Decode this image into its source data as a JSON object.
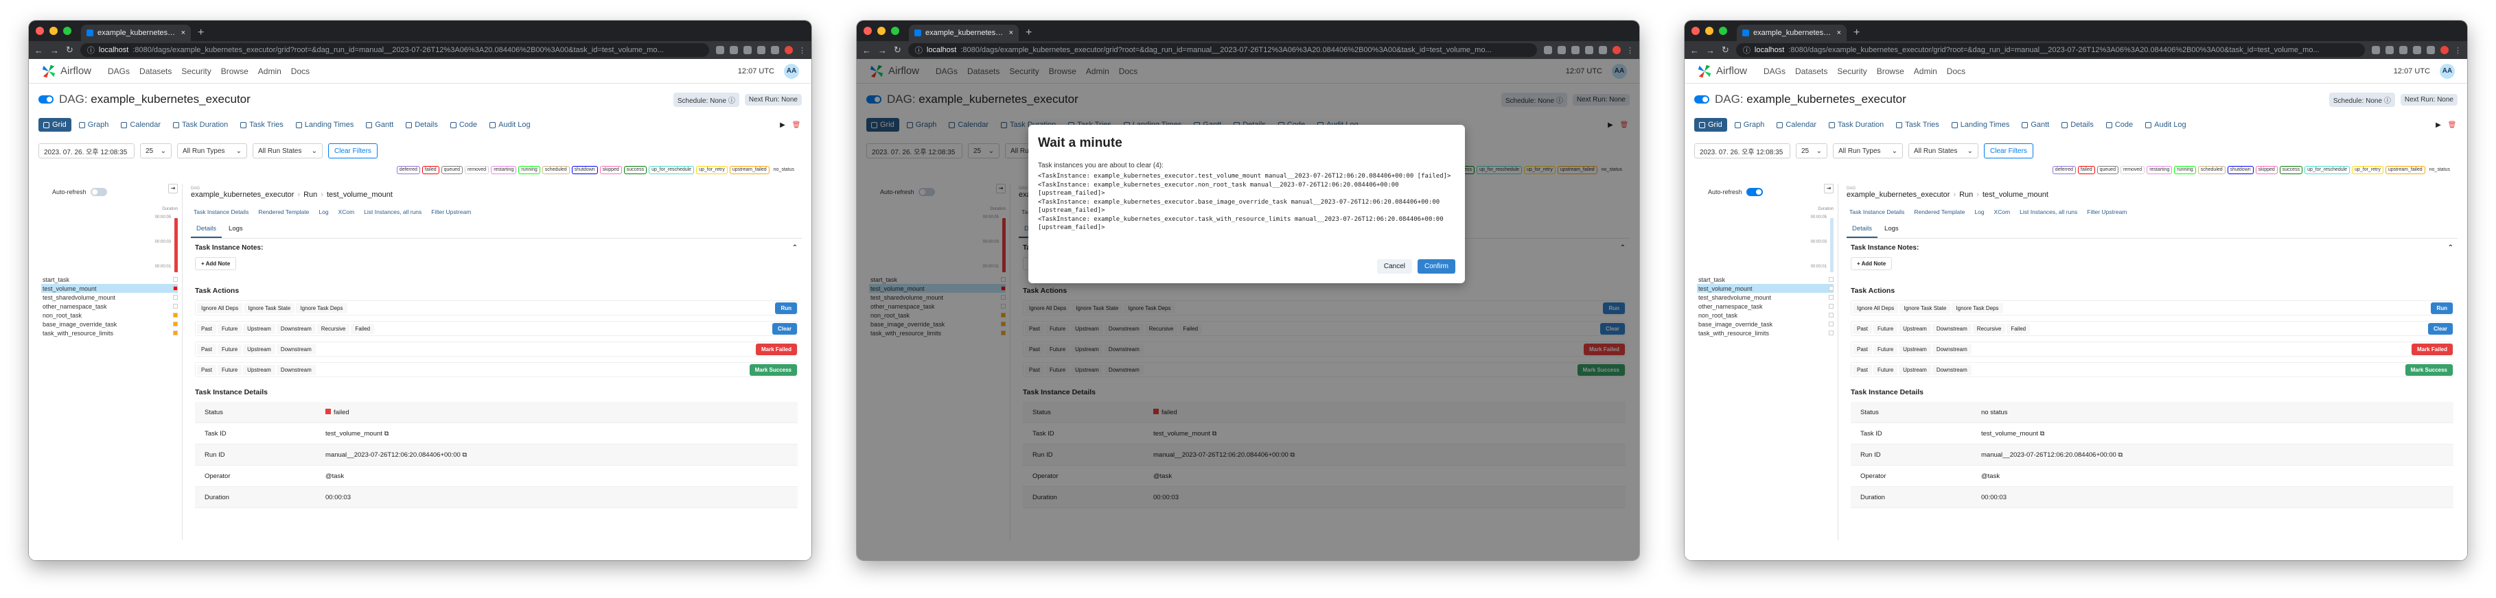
{
  "screenshots": [
    {
      "browser": {
        "tab_title": "example_kubernetes_execut",
        "url_host": "localhost",
        "url_path": ":8080/dags/example_kubernetes_executor/grid?root=&dag_run_id=manual__2023-07-26T12%3A06%3A20.084406%2B00%3A00&task_id=test_volume_mo..."
      },
      "nav": {
        "brand": "Airflow",
        "items": [
          "DAGs",
          "Datasets",
          "Security",
          "Browse",
          "Admin",
          "Docs"
        ],
        "time": "12:07 UTC",
        "user": "AA"
      },
      "dag": {
        "label": "DAG:",
        "name": "example_kubernetes_executor",
        "schedule": "Schedule: None",
        "next_run": "Next Run: None"
      },
      "views": [
        "Grid",
        "Graph",
        "Calendar",
        "Task Duration",
        "Task Tries",
        "Landing Times",
        "Gantt",
        "Details",
        "Code",
        "Audit Log"
      ],
      "filters": {
        "date": "2023. 07. 26. 오후 12:08:35",
        "count": "25",
        "run_types": "All Run Types",
        "run_states": "All Run States",
        "clear": "Clear Filters"
      },
      "legend": [
        "deferred",
        "failed",
        "queued",
        "removed",
        "restarting",
        "running",
        "scheduled",
        "shutdown",
        "skipped",
        "success",
        "up_for_reschedule",
        "up_for_retry",
        "upstream_failed",
        "no_status"
      ],
      "legend_colors": [
        "#9370db",
        "#ff0000",
        "#808080",
        "#d3d3d3",
        "#ee82ee",
        "#00ff00",
        "#d2b48c",
        "#0000ff",
        "#ff69b4",
        "#008000",
        "#40e0d0",
        "#ffd700",
        "#ffa500",
        "#ffffff"
      ],
      "grid": {
        "auto_refresh": "Auto-refresh",
        "duration": "Duration",
        "ticks": [
          "00:00:05",
          "00:00:03",
          "00:00:01"
        ],
        "tasks": [
          "start_task",
          "test_volume_mount",
          "test_sharedvolume_mount",
          "other_namespace_task",
          "non_root_task",
          "base_image_override_task",
          "task_with_resource_limits"
        ],
        "task_colors": [
          "#ffffff",
          "#ff0000",
          "#ffffff",
          "#ffffff",
          "#ffa500",
          "#ffa500",
          "#ffa500"
        ]
      },
      "detail": {
        "crumb_dag": "DAG",
        "crumb_run": "Run",
        "crumb_task": "Task",
        "dag_name": "example_kubernetes_executor",
        "run": "Run",
        "task": "test_volume_mount",
        "links": [
          "Task Instance Details",
          "Rendered Template",
          "Log",
          "XCom",
          "List Instances, all runs",
          "Filter Upstream"
        ],
        "tabs": [
          "Details",
          "Logs"
        ],
        "notes": "Task Instance Notes:",
        "add_note": "+ Add Note",
        "actions_title": "Task Actions",
        "row1": [
          "Ignore All Deps",
          "Ignore Task State",
          "Ignore Task Deps"
        ],
        "row2": [
          "Past",
          "Future",
          "Upstream",
          "Downstream",
          "Recursive",
          "Failed"
        ],
        "clear": "Clear",
        "row3": [
          "Past",
          "Future",
          "Upstream",
          "Downstream"
        ],
        "mark_failed": "Mark Failed",
        "row4": [
          "Past",
          "Future",
          "Upstream",
          "Downstream"
        ],
        "mark_success": "Mark Success",
        "details_title": "Task Instance Details",
        "rows": [
          {
            "k": "Status",
            "v": "failed"
          },
          {
            "k": "Task ID",
            "v": "test_volume_mount"
          },
          {
            "k": "Run ID",
            "v": "manual__2023-07-26T12:06:20.084406+00:00"
          },
          {
            "k": "Operator",
            "v": "@task"
          },
          {
            "k": "Duration",
            "v": "00:00:03"
          }
        ]
      }
    },
    {
      "modal": {
        "title": "Wait a minute",
        "subtitle": "Task instances you are about to clear (4):",
        "body": "<TaskInstance: example_kubernetes_executor.test_volume_mount manual__2023-07-26T12:06:20.084406+00:00 [failed]>\n<TaskInstance: example_kubernetes_executor.non_root_task manual__2023-07-26T12:06:20.084406+00:00 [upstream_failed]>\n<TaskInstance: example_kubernetes_executor.base_image_override_task manual__2023-07-26T12:06:20.084406+00:00 [upstream_failed]>\n<TaskInstance: example_kubernetes_executor.task_with_resource_limits manual__2023-07-26T12:06:20.084406+00:00 [upstream_failed]>",
        "cancel": "Cancel",
        "confirm": "Confirm"
      }
    },
    {
      "status_value": "no status",
      "task_colors": [
        "#ffffff",
        "#ffffff",
        "#ffffff",
        "#ffffff",
        "#ffffff",
        "#ffffff",
        "#ffffff"
      ]
    }
  ]
}
